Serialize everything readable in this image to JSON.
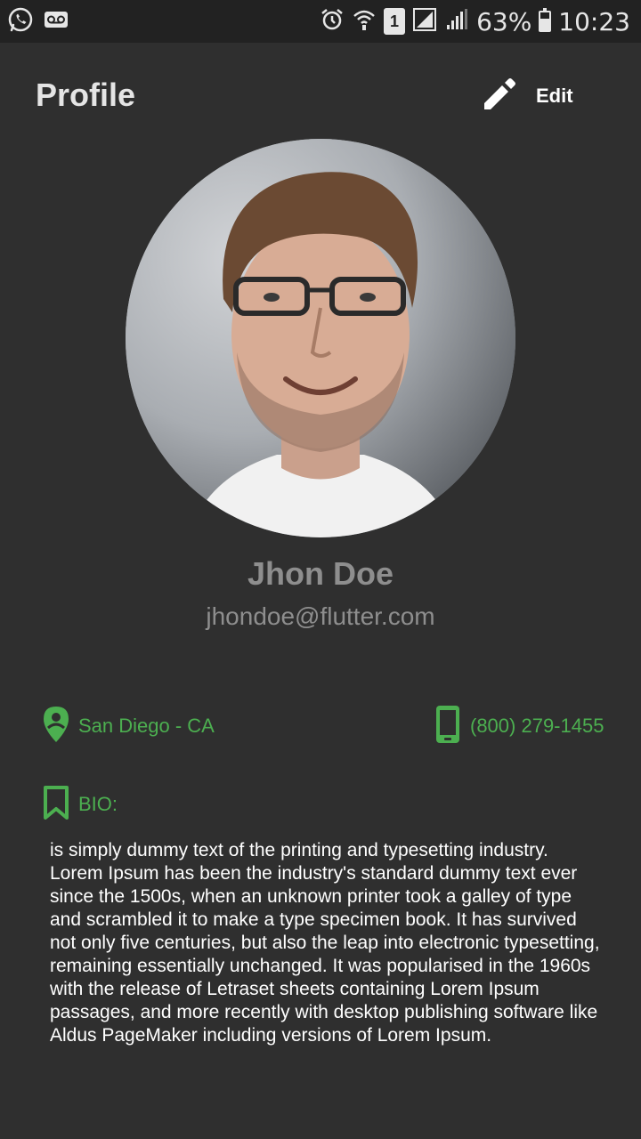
{
  "status_bar": {
    "sim_slot": "1",
    "battery_percent": "63%",
    "battery_level": 0.63,
    "time": "10:23",
    "icons": [
      "whatsapp-icon",
      "voicemail-icon",
      "alarm-icon",
      "wifi-icon",
      "signal-icon",
      "signal-icon",
      "battery-icon"
    ]
  },
  "header": {
    "title": "Profile",
    "edit_label": "Edit",
    "edit_icon": "pencil-icon"
  },
  "profile": {
    "name": "Jhon Doe",
    "email": "jhondoe@flutter.com"
  },
  "info": {
    "location": "San Diego - CA",
    "location_icon": "location-pin-icon",
    "phone": "(800) 279-1455",
    "phone_icon": "smartphone-icon"
  },
  "bio": {
    "label": "BIO:",
    "label_icon": "bookmark-icon",
    "text": "is simply dummy text of the printing and typesetting industry. Lorem Ipsum has been the industry's standard dummy text ever since the 1500s, when an unknown printer took a galley of type and scrambled it to make a type specimen book. It has survived not only five centuries, but also the leap into electronic typesetting, remaining essentially unchanged. It was popularised in the 1960s with the release of Letraset sheets containing Lorem Ipsum passages, and more recently with desktop publishing software like Aldus PageMaker including versions of Lorem Ipsum."
  },
  "colors": {
    "background": "#2f2f2f",
    "status_bar": "#222222",
    "accent_green": "#4caf50",
    "muted_text": "#8e8e8e"
  }
}
